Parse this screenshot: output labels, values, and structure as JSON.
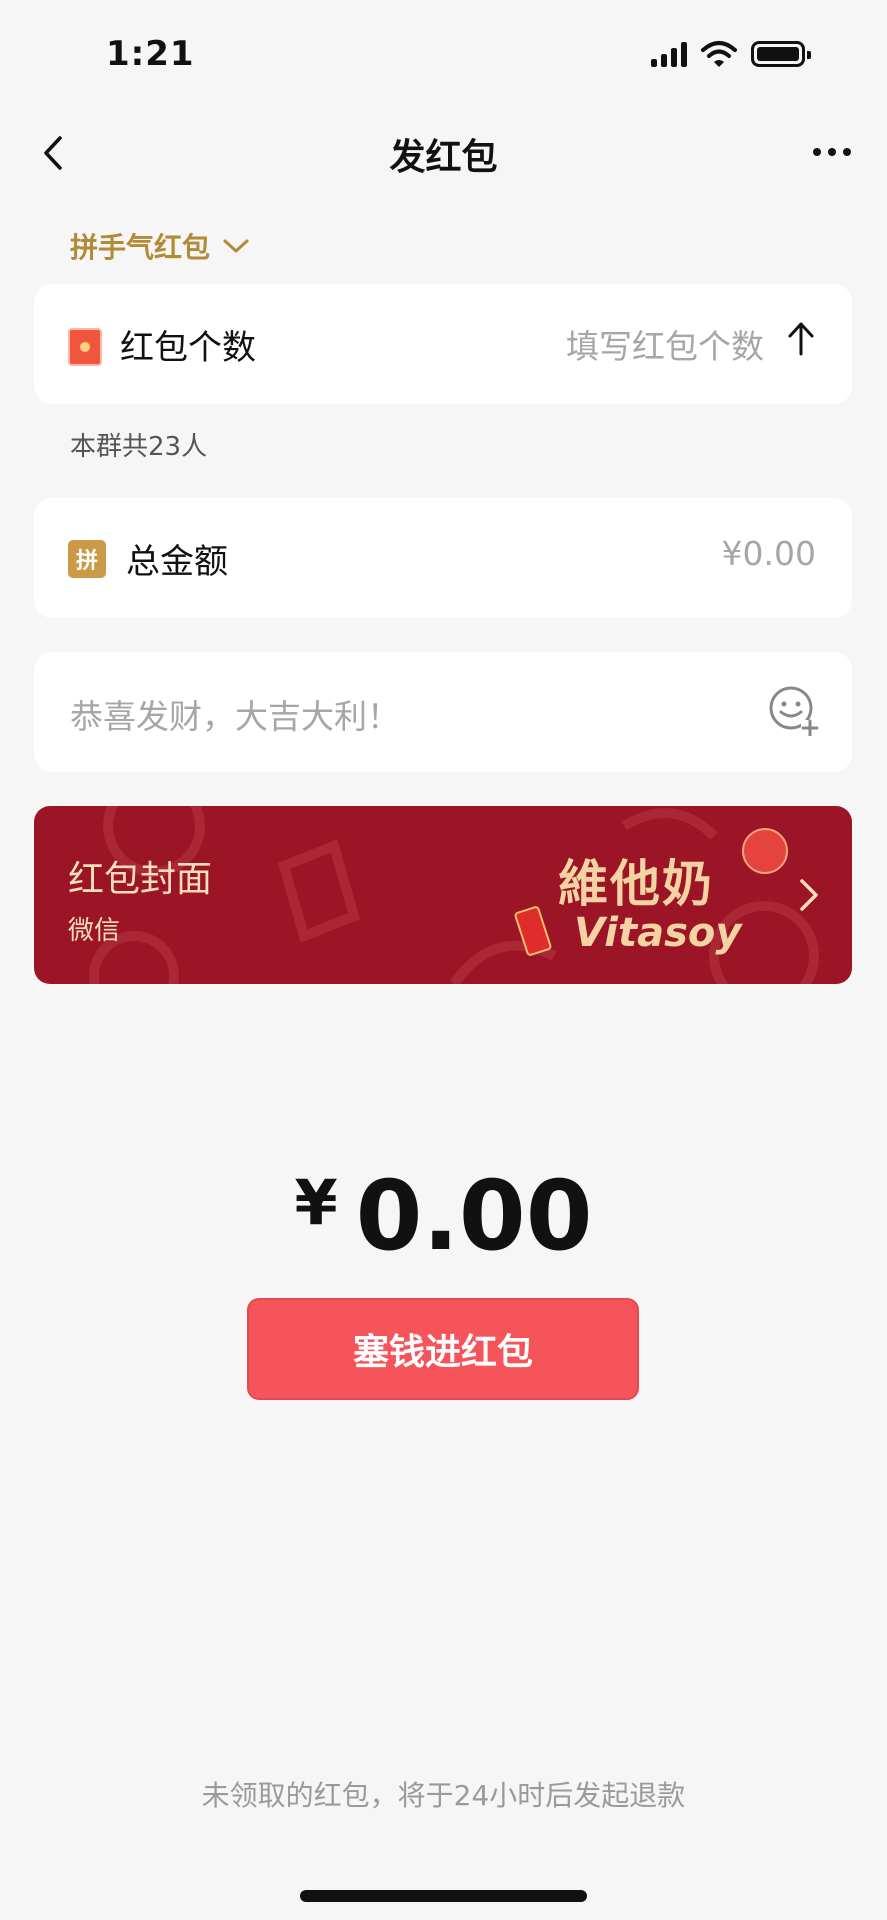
{
  "status_bar": {
    "time": "1:21"
  },
  "nav": {
    "title": "发红包",
    "back_icon": "chevron-left-icon",
    "more_icon": "more-dots-icon"
  },
  "packet_type": {
    "label": "拼手气红包"
  },
  "count_card": {
    "label": "红包个数",
    "placeholder": "填写红包个数"
  },
  "group_info": "本群共23人",
  "amount_card": {
    "icon_text": "拼",
    "label": "总金额",
    "value": "¥0.00"
  },
  "greeting": {
    "placeholder": "恭喜发财，大吉大利！"
  },
  "cover": {
    "title": "红包封面",
    "subtitle": "微信",
    "brand_cn": "維他奶",
    "brand_en": "Vitasoy",
    "bg_color": "#9c1526"
  },
  "total": {
    "currency": "¥",
    "value": "0.00"
  },
  "submit_button": {
    "label": "塞钱进红包",
    "color": "#f4545a"
  },
  "footer_note": "未领取的红包，将于24小时后发起退款"
}
